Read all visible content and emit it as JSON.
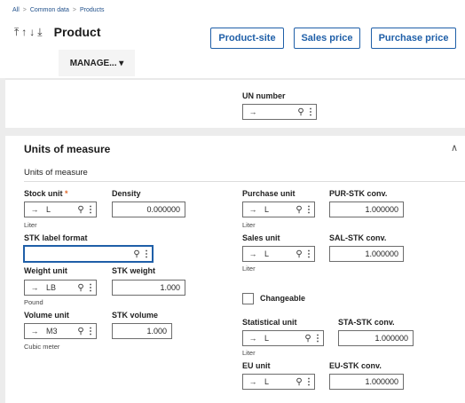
{
  "breadcrumb": [
    "All",
    "Common data",
    "Products"
  ],
  "header": {
    "title": "Product",
    "sort_icons": "⤒↑↓⤓",
    "buttons": {
      "product_site": "Product-site",
      "sales_price": "Sales price",
      "purchase_price": "Purchase price"
    },
    "manage_label": "MANAGE... ▾"
  },
  "prev_section": {
    "un_number_label": "UN number",
    "un_number_value": ""
  },
  "uom": {
    "title": "Units of measure",
    "subsection": "Units of measure",
    "stock_unit": {
      "label": "Stock unit",
      "value": "L",
      "desc": "Liter"
    },
    "density": {
      "label": "Density",
      "value": "0.000000"
    },
    "stk_label_format": {
      "label": "STK label format",
      "value": ""
    },
    "weight_unit": {
      "label": "Weight unit",
      "value": "LB",
      "desc": "Pound"
    },
    "stk_weight": {
      "label": "STK weight",
      "value": "1.000"
    },
    "volume_unit": {
      "label": "Volume unit",
      "value": "M3",
      "desc": "Cubic meter"
    },
    "stk_volume": {
      "label": "STK volume",
      "value": "1.000"
    },
    "purchase_unit": {
      "label": "Purchase unit",
      "value": "L",
      "desc": "Liter"
    },
    "pur_stk_conv": {
      "label": "PUR-STK conv.",
      "value": "1.000000"
    },
    "sales_unit": {
      "label": "Sales unit",
      "value": "L",
      "desc": "Liter"
    },
    "sal_stk_conv": {
      "label": "SAL-STK conv.",
      "value": "1.000000"
    },
    "changeable": {
      "label": "Changeable",
      "checked": false
    },
    "statistical_unit": {
      "label": "Statistical unit",
      "value": "L",
      "desc": "Liter"
    },
    "sta_stk_conv": {
      "label": "STA-STK conv.",
      "value": "1.000000"
    },
    "eu_unit": {
      "label": "EU unit",
      "value": "L"
    },
    "eu_stk_conv": {
      "label": "EU-STK conv.",
      "value": "1.000000"
    }
  },
  "glyphs": {
    "arrow": "→",
    "search": "⚲",
    "dots": "⋮",
    "collapse": "∧",
    "sep": ">",
    "required": "*"
  },
  "colors": {
    "accent": "#1f5fa8",
    "required": "#e06a2c"
  }
}
